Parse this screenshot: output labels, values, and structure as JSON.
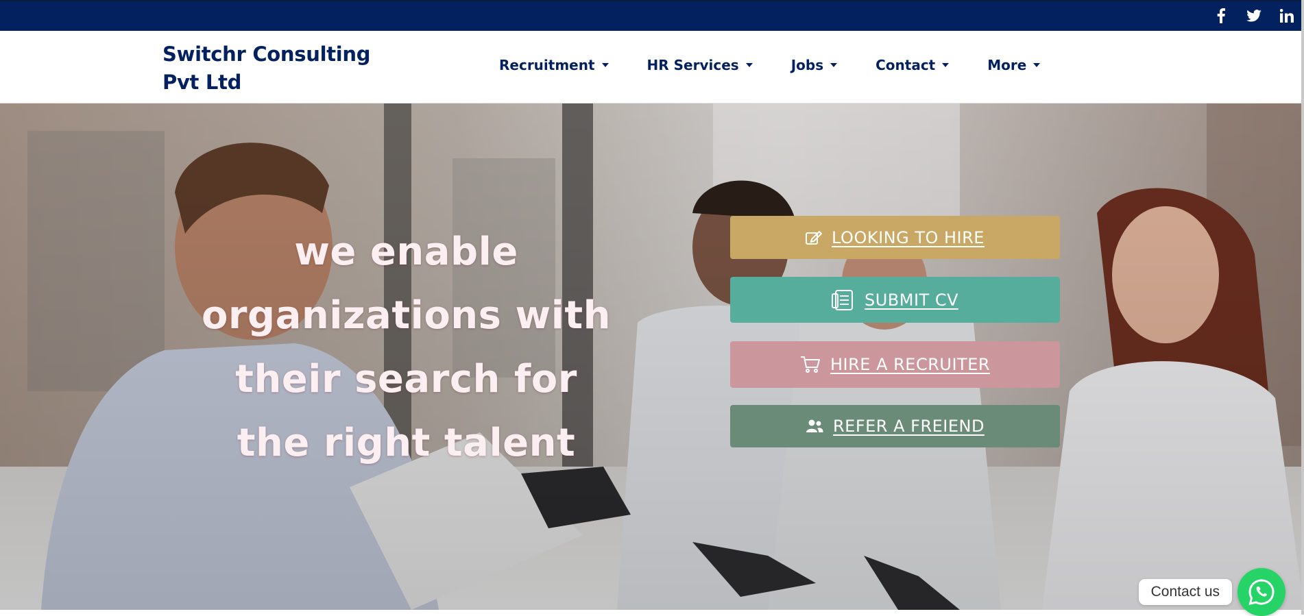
{
  "topbar": {
    "socials": [
      {
        "icon": "facebook-icon",
        "glyph": "f"
      },
      {
        "icon": "twitter-icon",
        "glyph": "🐦"
      },
      {
        "icon": "linkedin-icon",
        "glyph": "in"
      }
    ]
  },
  "header": {
    "logo_line1": "Switchr Consulting",
    "logo_line2": "Pvt Ltd",
    "nav": [
      {
        "label": "Recruitment"
      },
      {
        "label": "HR Services"
      },
      {
        "label": "Jobs"
      },
      {
        "label": "Contact"
      },
      {
        "label": "More"
      }
    ]
  },
  "hero": {
    "headline": "we enable organizations with their search for the right talent",
    "ctas": [
      {
        "label": "LOOKING TO HIRE",
        "icon": "edit-icon",
        "color": "#c8a864"
      },
      {
        "label": "SUBMIT CV",
        "icon": "document-icon",
        "color": "#57ad9b"
      },
      {
        "label": "HIRE A RECRUITER",
        "icon": "cart-icon",
        "color": "#cb979d"
      },
      {
        "label": "REFER A FREIEND",
        "icon": "users-icon",
        "color": "#6a8b77"
      }
    ]
  },
  "contact_widget": {
    "label": "Contact us",
    "icon": "whatsapp-icon"
  },
  "colors": {
    "brand_navy": "#03205f",
    "whatsapp_green": "#25d366"
  }
}
